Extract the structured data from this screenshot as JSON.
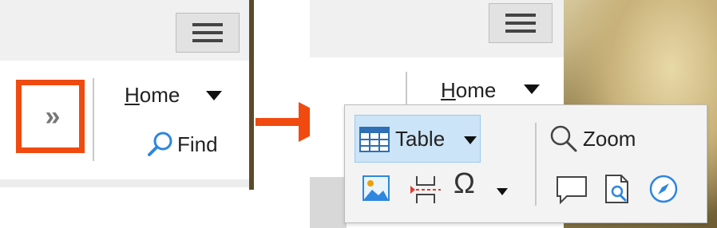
{
  "left": {
    "menu_button": "menu-icon",
    "overflow_button": "»",
    "home_label_first": "H",
    "home_label_rest": "ome",
    "find_label": "Find"
  },
  "right": {
    "menu_button": "menu-icon",
    "home_label_first": "H",
    "home_label_rest": "ome",
    "popup": {
      "table_label": "Table",
      "zoom_label": "Zoom",
      "omega_symbol": "Ω",
      "icons": [
        "table-grid-icon",
        "image-icon",
        "page-break-icon",
        "special-character-icon",
        "comment-icon",
        "document-search-icon",
        "compass-icon",
        "magnifier-icon"
      ]
    }
  },
  "colors": {
    "highlight_border": "#f04a10",
    "arrow": "#f04a10",
    "accent_blue": "#2e86de",
    "selected_bg": "#cce4f7"
  }
}
